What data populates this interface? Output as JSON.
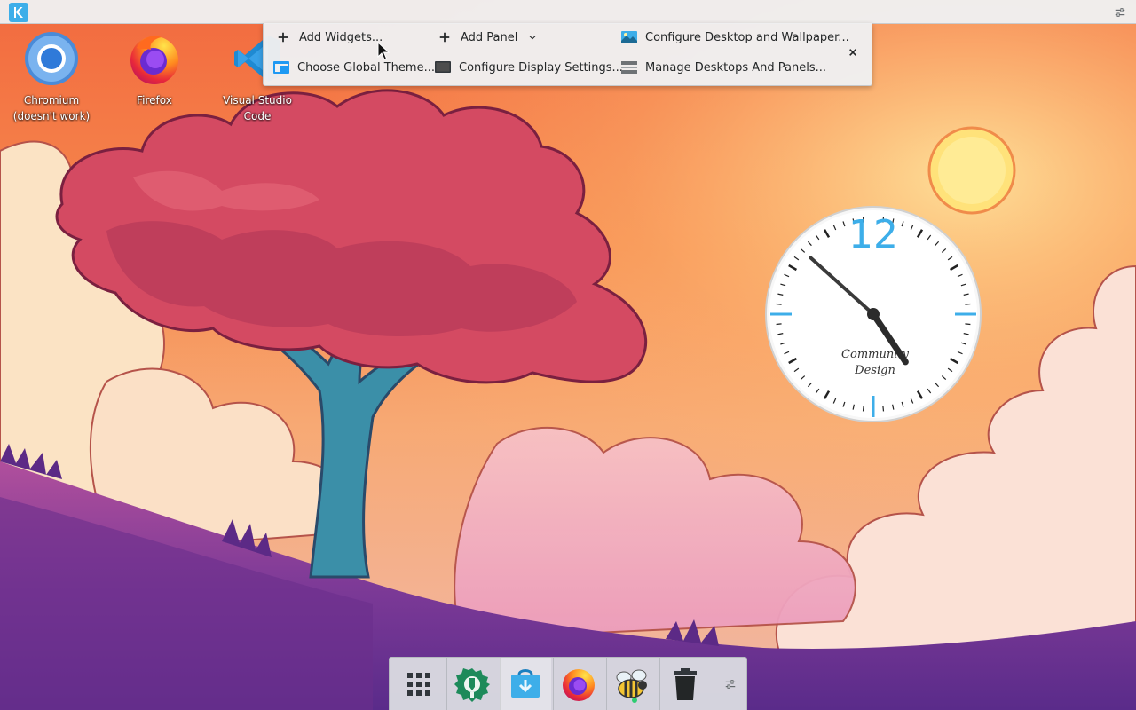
{
  "desktop": {
    "icons": [
      {
        "label": "Chromium (doesn't work)",
        "icon": "chromium-icon"
      },
      {
        "label": "Firefox",
        "icon": "firefox-icon"
      },
      {
        "label": "Visual Studio Code",
        "icon": "vscode-icon"
      }
    ]
  },
  "toolbox": {
    "add_widgets": "Add Widgets...",
    "add_panel": "Add Panel",
    "configure_desktop": "Configure Desktop and Wallpaper...",
    "choose_theme": "Choose Global Theme...",
    "configure_display": "Configure Display Settings...",
    "manage_desktops": "Manage Desktops And Panels...",
    "close": "✕"
  },
  "clock": {
    "numeral": "12",
    "brand_line1": "Community",
    "brand_line2": "Design",
    "hour": 4,
    "minute": 52,
    "accent_color": "#3daee9"
  },
  "dock": {
    "items": [
      {
        "name": "application-launcher",
        "icon": "app-grid-icon"
      },
      {
        "name": "system-settings",
        "icon": "settings-gear-icon"
      },
      {
        "name": "discover-store",
        "icon": "discover-icon",
        "active": true
      },
      {
        "name": "firefox",
        "icon": "firefox-icon"
      },
      {
        "name": "kbeeswarm",
        "icon": "bee-icon"
      },
      {
        "name": "trash",
        "icon": "trash-icon"
      }
    ]
  },
  "colors": {
    "panel_bg": "#eff0f1",
    "kde_blue": "#3daee9"
  }
}
